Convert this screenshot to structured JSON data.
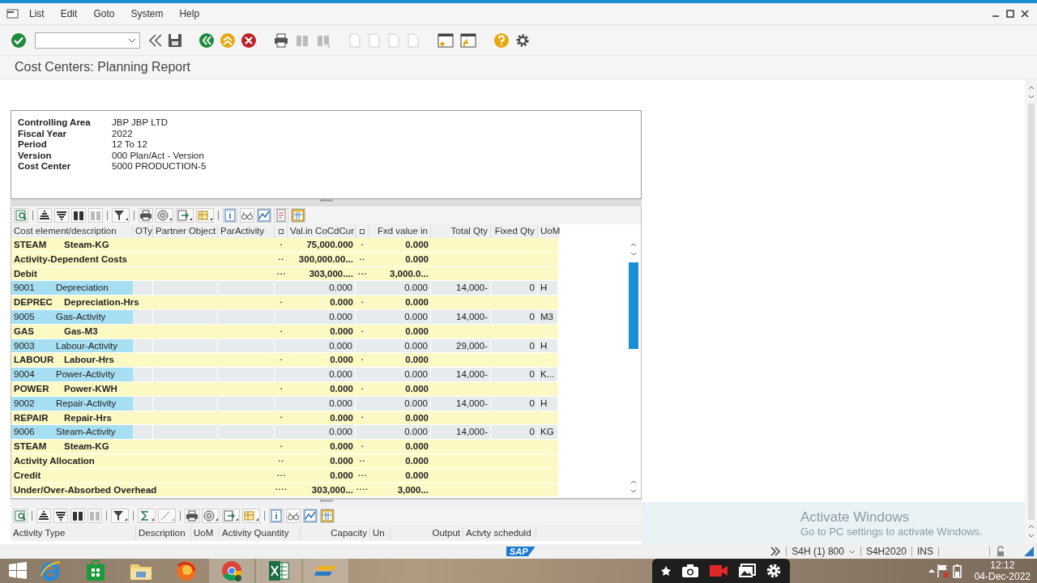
{
  "menu": [
    {
      "label": "List"
    },
    {
      "label": "Edit"
    },
    {
      "label": "Goto"
    },
    {
      "label": "System"
    },
    {
      "label": "Help"
    }
  ],
  "title": "Cost Centers: Planning Report",
  "header_info": [
    {
      "label": "Controlling Area",
      "value": "JBP JBP LTD"
    },
    {
      "label": "Fiscal Year",
      "value": "2022"
    },
    {
      "label": "Period",
      "value": "12 To 12"
    },
    {
      "label": "Version",
      "value": "000 Plan/Act - Version"
    },
    {
      "label": "Cost Center",
      "value": "5000 PRODUCTION-5"
    }
  ],
  "report_table": {
    "columns": [
      "Cost element/description",
      "OTy",
      "Partner Object",
      "ParActivity",
      "Val.in CoCdCur",
      "Fxd value in",
      "Total Qty",
      "Fixed Qty",
      "UoM"
    ],
    "rows": [
      {
        "kind": "total",
        "code": "STEAM",
        "description": "Steam-KG",
        "level_1": "•",
        "value": "75,000.000",
        "level_2": "•",
        "fixed_value": "0.000"
      },
      {
        "kind": "summary",
        "label": "Activity-Dependent Costs",
        "level_1": "• •",
        "value": "300,000.00...",
        "level_2": "• •",
        "fixed_value": "0.000"
      },
      {
        "kind": "summary",
        "label": "Debit",
        "level_1": "• • •",
        "value": "303,000....",
        "level_2": "• • •",
        "fixed_value": "3,000.0..."
      },
      {
        "kind": "item",
        "code": "9001",
        "description": "Depreciation",
        "value": "0.000",
        "fixed_value": "0.000",
        "total_qty": "14,000-",
        "fixed_qty": "0",
        "uom": "H"
      },
      {
        "kind": "total",
        "code": "DEPREC",
        "description": "Depreciation-Hrs",
        "level_1": "•",
        "value": "0.000",
        "level_2": "•",
        "fixed_value": "0.000"
      },
      {
        "kind": "item",
        "code": "9005",
        "description": "Gas-Activity",
        "value": "0.000",
        "fixed_value": "0.000",
        "total_qty": "14,000-",
        "fixed_qty": "0",
        "uom": "M3"
      },
      {
        "kind": "total",
        "code": "GAS",
        "description": "Gas-M3",
        "level_1": "•",
        "value": "0.000",
        "level_2": "•",
        "fixed_value": "0.000"
      },
      {
        "kind": "item",
        "code": "9003",
        "description": "Labour-Activity",
        "value": "0.000",
        "fixed_value": "0.000",
        "total_qty": "29,000-",
        "fixed_qty": "0",
        "uom": "H"
      },
      {
        "kind": "total",
        "code": "LABOUR",
        "description": "Labour-Hrs",
        "level_1": "•",
        "value": "0.000",
        "level_2": "•",
        "fixed_value": "0.000"
      },
      {
        "kind": "item",
        "code": "9004",
        "description": "Power-Activity",
        "value": "0.000",
        "fixed_value": "0.000",
        "total_qty": "14,000-",
        "fixed_qty": "0",
        "uom": "K..."
      },
      {
        "kind": "total",
        "code": "POWER",
        "description": "Power-KWH",
        "level_1": "•",
        "value": "0.000",
        "level_2": "•",
        "fixed_value": "0.000"
      },
      {
        "kind": "item",
        "code": "9002",
        "description": "Repair-Activity",
        "value": "0.000",
        "fixed_value": "0.000",
        "total_qty": "14,000-",
        "fixed_qty": "0",
        "uom": "H"
      },
      {
        "kind": "total",
        "code": "REPAIR",
        "description": "Repair-Hrs",
        "level_1": "•",
        "value": "0.000",
        "level_2": "•",
        "fixed_value": "0.000"
      },
      {
        "kind": "item",
        "code": "9006",
        "description": "Steam-Activity",
        "value": "0.000",
        "fixed_value": "0.000",
        "total_qty": "14,000-",
        "fixed_qty": "0",
        "uom": "KG"
      },
      {
        "kind": "total",
        "code": "STEAM",
        "description": "Steam-KG",
        "level_1": "•",
        "value": "0.000",
        "level_2": "•",
        "fixed_value": "0.000"
      },
      {
        "kind": "summary",
        "label": "Activity Allocation",
        "level_1": "• •",
        "value": "0.000",
        "level_2": "• •",
        "fixed_value": "0.000"
      },
      {
        "kind": "summary",
        "label": "Credit",
        "level_1": "• • •",
        "value": "0.000",
        "level_2": "• • •",
        "fixed_value": "0.000"
      },
      {
        "kind": "summary",
        "label": "Under/Over-Absorbed Overhead",
        "level_1": "• • • •",
        "value": "303,000...",
        "level_2": "• • • •",
        "fixed_value": "3,000..."
      }
    ]
  },
  "activity_table": {
    "columns": [
      "Activity Type",
      "Description",
      "UoM",
      "Activity Quantity",
      "Capacity",
      "Un",
      "Output",
      "Actvty scheduld"
    ]
  },
  "logo": "SAP",
  "windows_notice": {
    "title": "Activate Windows",
    "text": "Go to PC settings to activate Windows."
  },
  "status_bar": {
    "system": "S4H (1) 800",
    "server": "S4H2020",
    "mode": "INS"
  },
  "clock": {
    "time": "12:12",
    "date": "04-Dec-2022"
  }
}
